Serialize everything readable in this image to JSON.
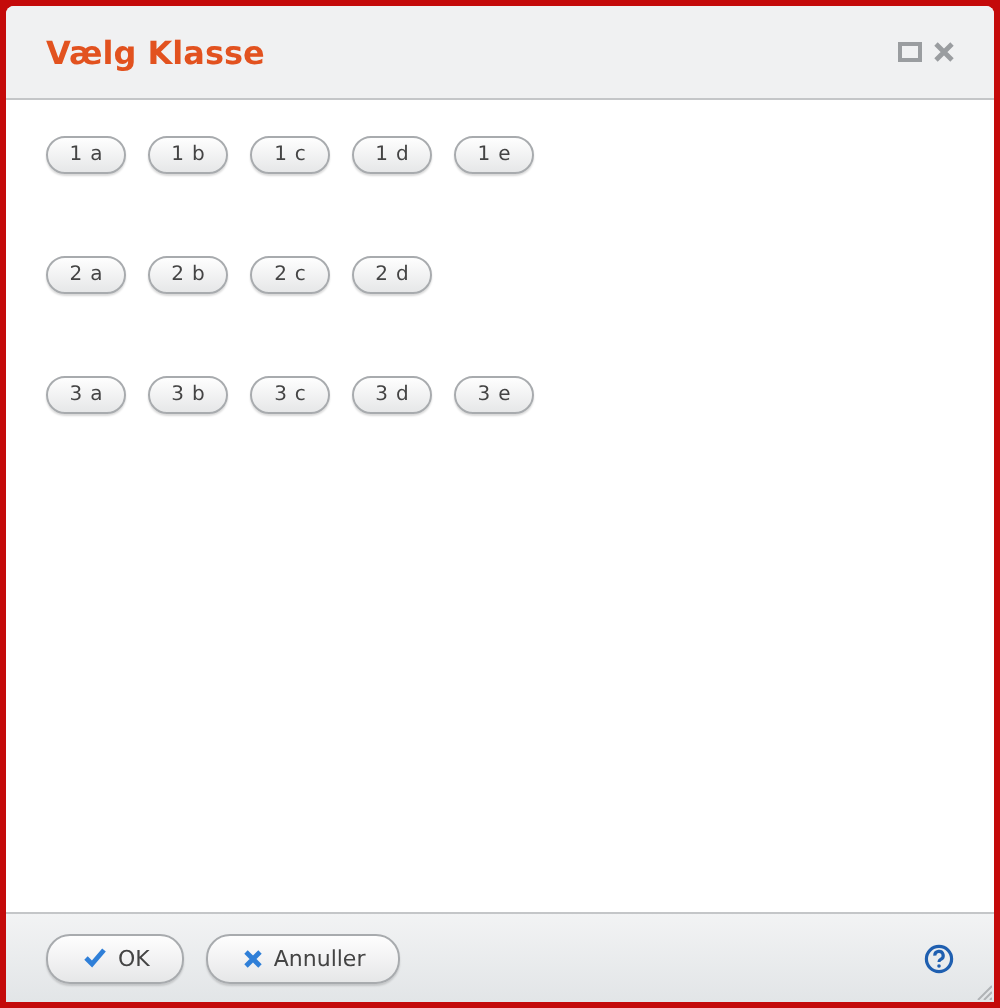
{
  "window": {
    "title": "Vælg Klasse"
  },
  "class_rows": [
    {
      "classes": [
        "1a",
        "1b",
        "1c",
        "1d",
        "1e"
      ]
    },
    {
      "classes": [
        "2a",
        "2b",
        "2c",
        "2d"
      ]
    },
    {
      "classes": [
        "3a",
        "3b",
        "3c",
        "3d",
        "3e"
      ]
    }
  ],
  "buttons": [
    {
      "kind": "ok",
      "label": "OK"
    },
    {
      "kind": "cancel",
      "label": "Annuller"
    }
  ]
}
